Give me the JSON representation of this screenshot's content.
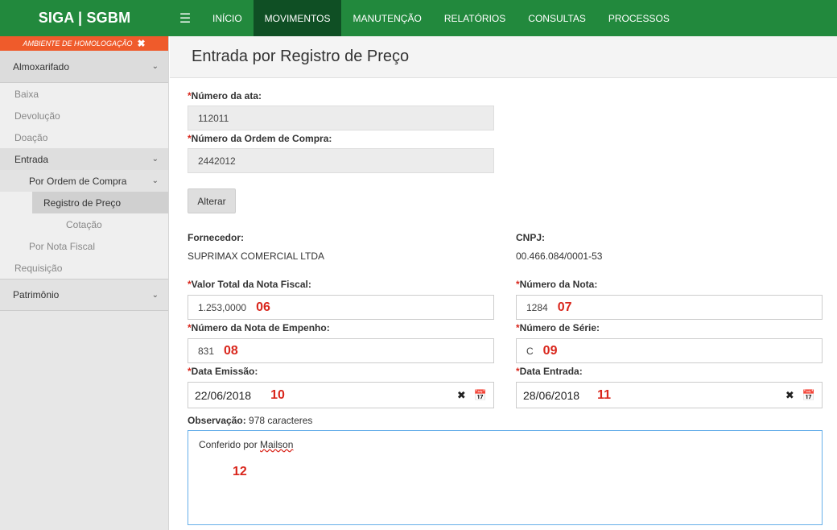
{
  "app": {
    "brand": "SIGA | SGBM"
  },
  "nav": {
    "menu_icon": "hamburger-icon",
    "items": [
      {
        "label": "INÍCIO"
      },
      {
        "label": "MOVIMENTOS"
      },
      {
        "label": "MANUTENÇÃO"
      },
      {
        "label": "RELATÓRIOS"
      },
      {
        "label": "CONSULTAS"
      },
      {
        "label": "PROCESSOS"
      }
    ],
    "active": "MOVIMENTOS"
  },
  "sidebar": {
    "environment": "AMBIENTE DE HOMOLOGAÇÃO",
    "sections": {
      "almoxarifado": "Almoxarifado",
      "patrimonio": "Patrimônio"
    },
    "items": {
      "baixa": "Baixa",
      "devolucao": "Devolução",
      "doacao": "Doação",
      "entrada": "Entrada",
      "por_ordem": "Por Ordem de Compra",
      "registro_preco": "Registro de Preço",
      "cotacao": "Cotação",
      "por_nota": "Por Nota Fiscal",
      "requisicao": "Requisição"
    }
  },
  "page": {
    "title": "Entrada por Registro de Preço"
  },
  "form": {
    "required_mark": "*",
    "numero_ata": {
      "label": "Número da ata:",
      "value": "112011"
    },
    "numero_ordem": {
      "label": "Número da Ordem de Compra:",
      "value": "2442012"
    },
    "alterar_button": "Alterar",
    "fornecedor": {
      "label": "Fornecedor:",
      "value": "SUPRIMAX COMERCIAL LTDA"
    },
    "cnpj": {
      "label": "CNPJ:",
      "value": "00.466.084/0001-53"
    },
    "valor_total": {
      "label": "Valor Total da Nota Fiscal:",
      "value": "1.253,0000",
      "marker": "06"
    },
    "numero_nota": {
      "label": "Número da Nota:",
      "value": "1284",
      "marker": "07"
    },
    "nota_empenho": {
      "label": "Número da Nota de Empenho:",
      "value": "831",
      "marker": "08"
    },
    "numero_serie": {
      "label": "Número de Série:",
      "value": "C",
      "marker": "09"
    },
    "data_emissao": {
      "label": "Data Emissão:",
      "value": "22/06/2018",
      "marker": "10"
    },
    "data_entrada": {
      "label": "Data Entrada:",
      "value": "28/06/2018",
      "marker": "11"
    },
    "observacao": {
      "label": "Observação:",
      "counter": "978 caracteres",
      "text_prefix": "Conferido por ",
      "text_name": "Mailson",
      "marker": "12"
    },
    "clear_icon": "close-icon",
    "calendar_icon": "calendar-icon"
  }
}
